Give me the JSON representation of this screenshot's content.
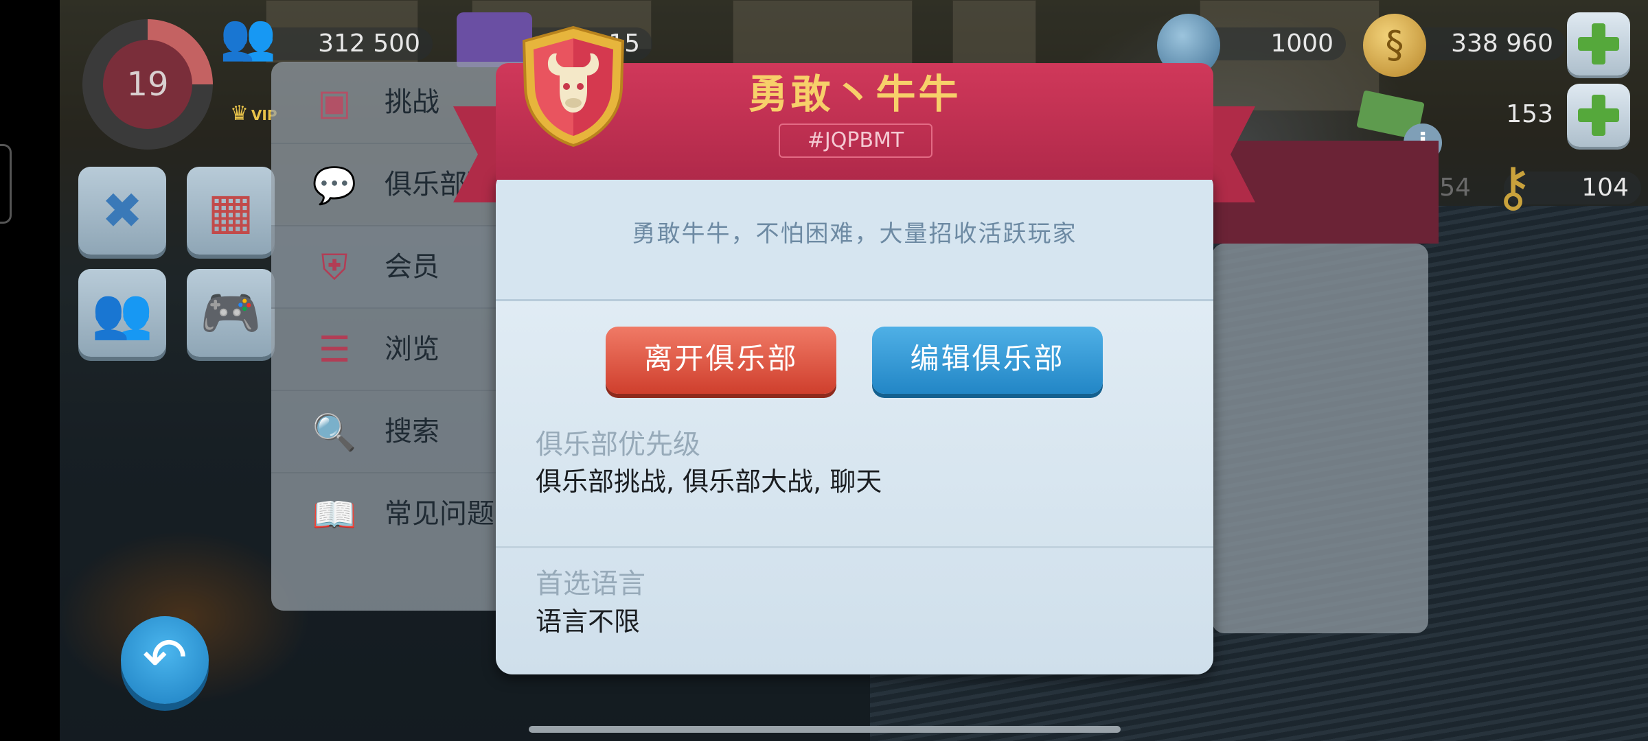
{
  "hud": {
    "level": "19",
    "population": "312 500",
    "storage": "15",
    "water": "1000",
    "simoleons": "338 960",
    "simcash": "153",
    "golden_keys_partial": "54",
    "keys": "104",
    "vip_label": "VIP"
  },
  "side_menu": {
    "items": [
      {
        "label": "挑战",
        "icon": "treasure-chest-icon"
      },
      {
        "label": "俱乐部聊天",
        "icon": "chat-bubble-icon"
      },
      {
        "label": "会员",
        "icon": "club-shield-icon"
      },
      {
        "label": "浏览",
        "icon": "browse-shield-icon"
      },
      {
        "label": "搜索",
        "icon": "search-shield-icon"
      },
      {
        "label": "常见问题",
        "icon": "faq-book-icon"
      }
    ]
  },
  "club": {
    "name": "勇敢丶牛牛",
    "tag": "#JQPBMT",
    "description": "勇敢牛牛，不怕困难，大量招收活跃玩家",
    "leave_button": "离开俱乐部",
    "edit_button": "编辑俱乐部",
    "priority_label": "俱乐部优先级",
    "priority_value": "俱乐部挑战, 俱乐部大战, 聊天",
    "language_label": "首选语言",
    "language_value": "语言不限"
  },
  "colors": {
    "banner": "#c0304f",
    "title_gold": "#f7d06a",
    "leave_red": "#d9483a",
    "edit_blue": "#2b8ccb"
  }
}
